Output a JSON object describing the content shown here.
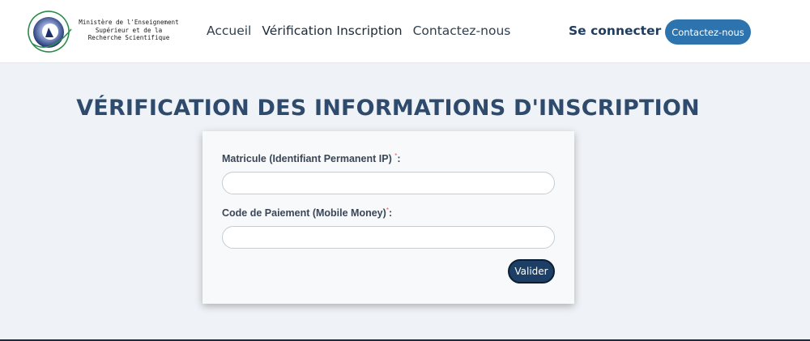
{
  "header": {
    "logo": {
      "icon": "ministry-logo",
      "lines": [
        "Ministère de l'Enseignement",
        "Supérieur et de la",
        "Recherche Scientifique"
      ]
    },
    "nav": [
      {
        "label": "Accueil"
      },
      {
        "label": "Vérification Inscription"
      },
      {
        "label": "Contactez-nous"
      }
    ],
    "login_label": "Se connecter",
    "contact_button_label": "Contactez-nous"
  },
  "main": {
    "title": "VÉRIFICATION DES INFORMATIONS D'INSCRIPTION",
    "form": {
      "fields": [
        {
          "label": "Matricule (Identifiant Permanent IP) ",
          "required_mark": "*",
          "suffix": ":",
          "value": "",
          "placeholder": ""
        },
        {
          "label": "Code de Paiement (Mobile Money)",
          "required_mark": "*",
          "suffix": ":",
          "value": "",
          "placeholder": ""
        }
      ],
      "submit_label": "Valider"
    }
  },
  "colors": {
    "accent": "#2d73ad",
    "primary_dark": "#1d3f66",
    "title": "#2e4a6c",
    "background": "#eff2f6"
  }
}
